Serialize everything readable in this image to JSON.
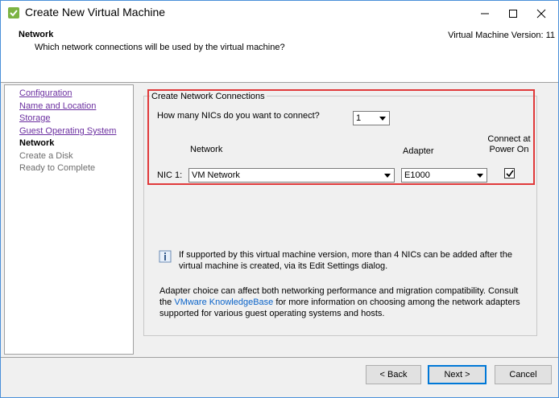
{
  "window": {
    "title": "Create New Virtual Machine",
    "controls": {
      "minimize": "minimize-icon",
      "maximize": "maximize-icon",
      "close": "close-icon"
    }
  },
  "header": {
    "title": "Network",
    "subtitle": "Which network connections will be used by the virtual machine?",
    "version": "Virtual Machine Version: 11"
  },
  "nav": {
    "items": [
      {
        "label": "Configuration",
        "state": "link"
      },
      {
        "label": "Name and Location",
        "state": "link"
      },
      {
        "label": "Storage",
        "state": "link"
      },
      {
        "label": "Guest Operating System",
        "state": "link"
      },
      {
        "label": "Network",
        "state": "current"
      },
      {
        "label": "Create a Disk",
        "state": "future"
      },
      {
        "label": "Ready to Complete",
        "state": "future"
      }
    ]
  },
  "network": {
    "group_title": "Create Network Connections",
    "question": "How many NICs do you want to connect?",
    "nic_count": "1",
    "col_network": "Network",
    "col_adapter": "Adapter",
    "col_connect_line1": "Connect at",
    "col_connect_line2": "Power On",
    "nic_label": "NIC 1:",
    "network_value": "VM Network",
    "adapter_value": "E1000",
    "connect_checked": true,
    "highlight_color": "#e0393a"
  },
  "info": {
    "icon": "info-icon",
    "text": "If supported by this virtual machine version, more than 4 NICs can be added after the virtual machine is created, via its Edit Settings dialog.",
    "adapter_text_before": "Adapter choice can affect both networking performance and migration compatibility. Consult the ",
    "kb_link": "VMware KnowledgeBase",
    "adapter_text_after": " for more information on choosing among the network adapters supported for various guest operating systems and hosts."
  },
  "footer": {
    "back": "< Back",
    "next": "Next >",
    "cancel": "Cancel"
  },
  "colors": {
    "link": "#6b2fa0",
    "kb_link": "#0a63c9",
    "accent": "#0078d7"
  }
}
